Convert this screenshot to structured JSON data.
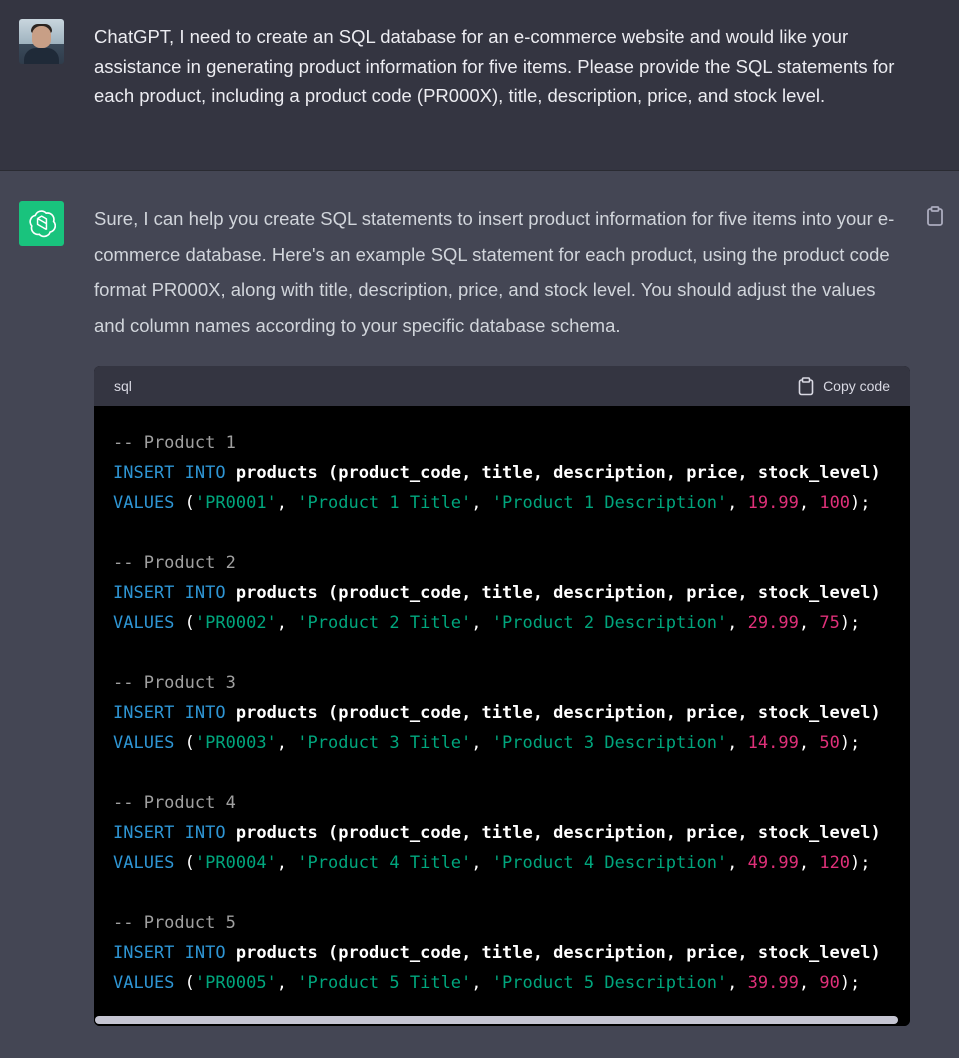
{
  "user_message": {
    "text": "ChatGPT, I need to create an SQL database for an e-commerce website and would like your assistance in generating product information for five items. Please provide the SQL statements for each product, including a product code (PR000X), title, description, price, and stock level."
  },
  "assistant_message": {
    "text": "Sure, I can help you create SQL statements to insert product information for five items into your e-commerce database. Here's an example SQL statement for each product, using the product code format PR000X, along with title, description, price, and stock level. You should adjust the values and column names according to your specific database schema.",
    "copy_icon": "clipboard-icon"
  },
  "code_block": {
    "language": "sql",
    "copy_label": "Copy code",
    "statements": [
      {
        "comment": "-- Product 1",
        "insert": "INSERT",
        "into": "INTO",
        "table": "products",
        "columns": "(product_code, title, description, price, stock_level)",
        "values_kw": "VALUES",
        "code": "'PR0001'",
        "title": "'Product 1 Title'",
        "description": "'Product 1 Description'",
        "price": "19.99",
        "stock": "100"
      },
      {
        "comment": "-- Product 2",
        "insert": "INSERT",
        "into": "INTO",
        "table": "products",
        "columns": "(product_code, title, description, price, stock_level)",
        "values_kw": "VALUES",
        "code": "'PR0002'",
        "title": "'Product 2 Title'",
        "description": "'Product 2 Description'",
        "price": "29.99",
        "stock": "75"
      },
      {
        "comment": "-- Product 3",
        "insert": "INSERT",
        "into": "INTO",
        "table": "products",
        "columns": "(product_code, title, description, price, stock_level)",
        "values_kw": "VALUES",
        "code": "'PR0003'",
        "title": "'Product 3 Title'",
        "description": "'Product 3 Description'",
        "price": "14.99",
        "stock": "50"
      },
      {
        "comment": "-- Product 4",
        "insert": "INSERT",
        "into": "INTO",
        "table": "products",
        "columns": "(product_code, title, description, price, stock_level)",
        "values_kw": "VALUES",
        "code": "'PR0004'",
        "title": "'Product 4 Title'",
        "description": "'Product 4 Description'",
        "price": "49.99",
        "stock": "120"
      },
      {
        "comment": "-- Product 5",
        "insert": "INSERT",
        "into": "INTO",
        "table": "products",
        "columns": "(product_code, title, description, price, stock_level)",
        "values_kw": "VALUES",
        "code": "'PR0005'",
        "title": "'Product 5 Title'",
        "description": "'Product 5 Description'",
        "price": "39.99",
        "stock": "90"
      }
    ]
  },
  "colors": {
    "user_bg": "#343541",
    "assistant_bg": "#444654",
    "brand": "#19c37d",
    "keyword": "#2e95d3",
    "string": "#00a67d",
    "number": "#df3079",
    "comment": "#a0a0a0"
  }
}
